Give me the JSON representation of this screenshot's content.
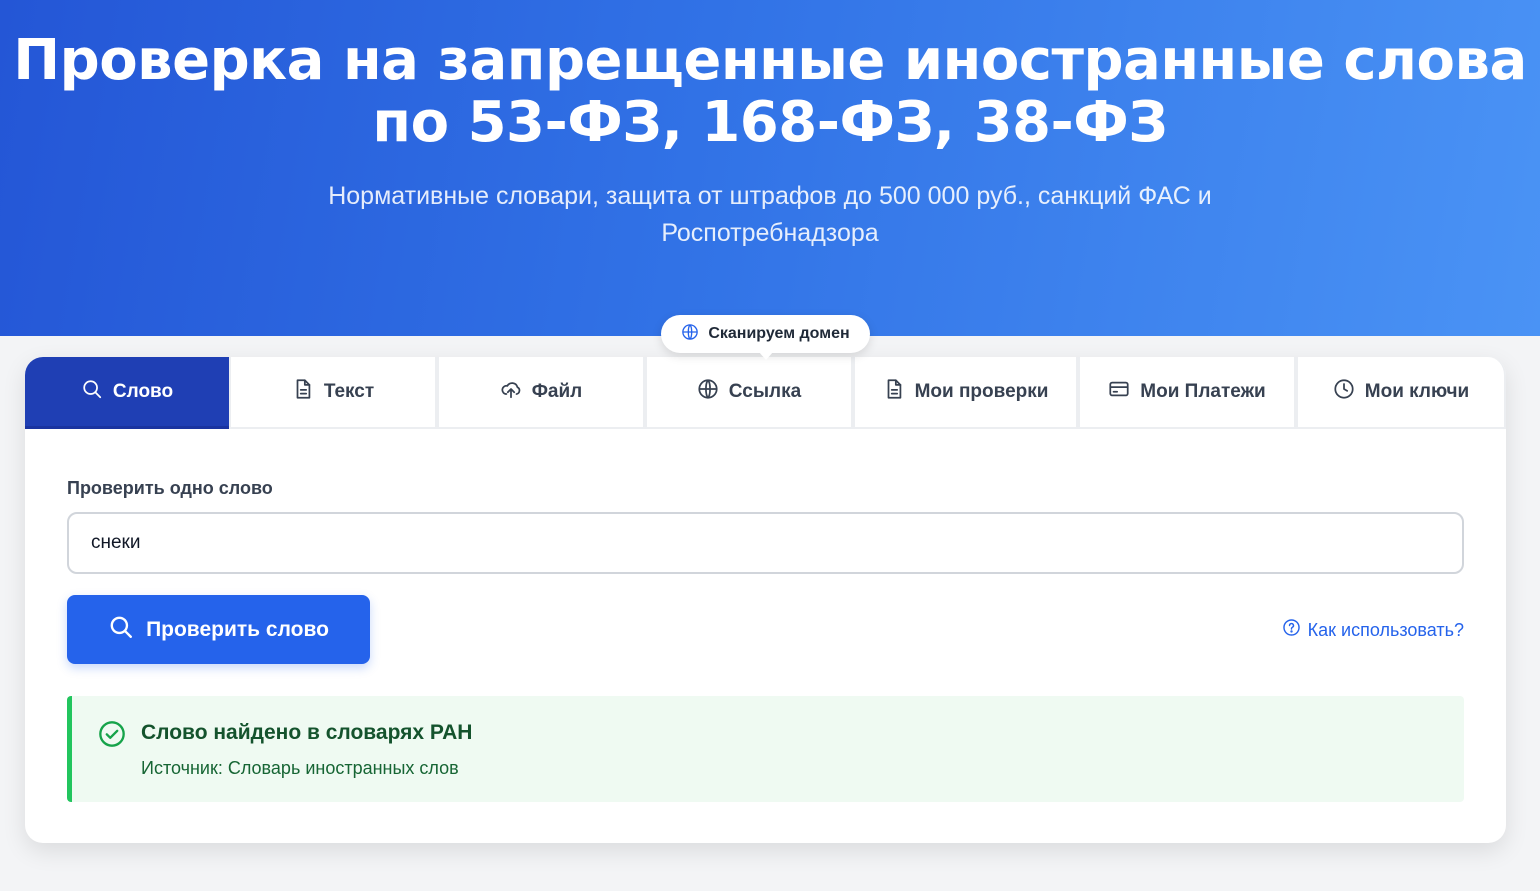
{
  "hero": {
    "title_line1": "Проверка на запрещенные иностранные слова",
    "title_line2": "по 53-ФЗ, 168-ФЗ, 38-ФЗ",
    "subtitle_line1": "Нормативные словари, защита от штрафов до 500 000 руб., санкций ФАС и",
    "subtitle_line2": "Роспотребнадзора"
  },
  "scan_badge": {
    "label": "Сканируем домен",
    "icon": "globe-icon"
  },
  "tabs": [
    {
      "label": "Слово",
      "icon": "search-icon",
      "active": true
    },
    {
      "label": "Текст",
      "icon": "document-icon",
      "active": false
    },
    {
      "label": "Файл",
      "icon": "cloud-upload-icon",
      "active": false
    },
    {
      "label": "Ссылка",
      "icon": "globe-icon",
      "active": false
    },
    {
      "label": "Мои проверки",
      "icon": "document-icon",
      "active": false
    },
    {
      "label": "Мои Платежи",
      "icon": "credit-card-icon",
      "active": false
    },
    {
      "label": "Мои ключи",
      "icon": "clock-icon",
      "active": false
    }
  ],
  "form": {
    "label": "Проверить одно слово",
    "input_value": "снеки",
    "submit_label": "Проверить слово",
    "help_label": "Как использовать?"
  },
  "result": {
    "title": "Слово найдено в словарях РАН",
    "source": "Источник: Словарь иностранных слов",
    "status": "success"
  },
  "colors": {
    "hero_gradient_start": "#2456d6",
    "hero_gradient_end": "#4a93f5",
    "active_tab": "#1f3fb4",
    "primary_button": "#2563eb",
    "success_bg": "#effaf2",
    "success_accent": "#22c55e",
    "success_text": "#14532d"
  }
}
